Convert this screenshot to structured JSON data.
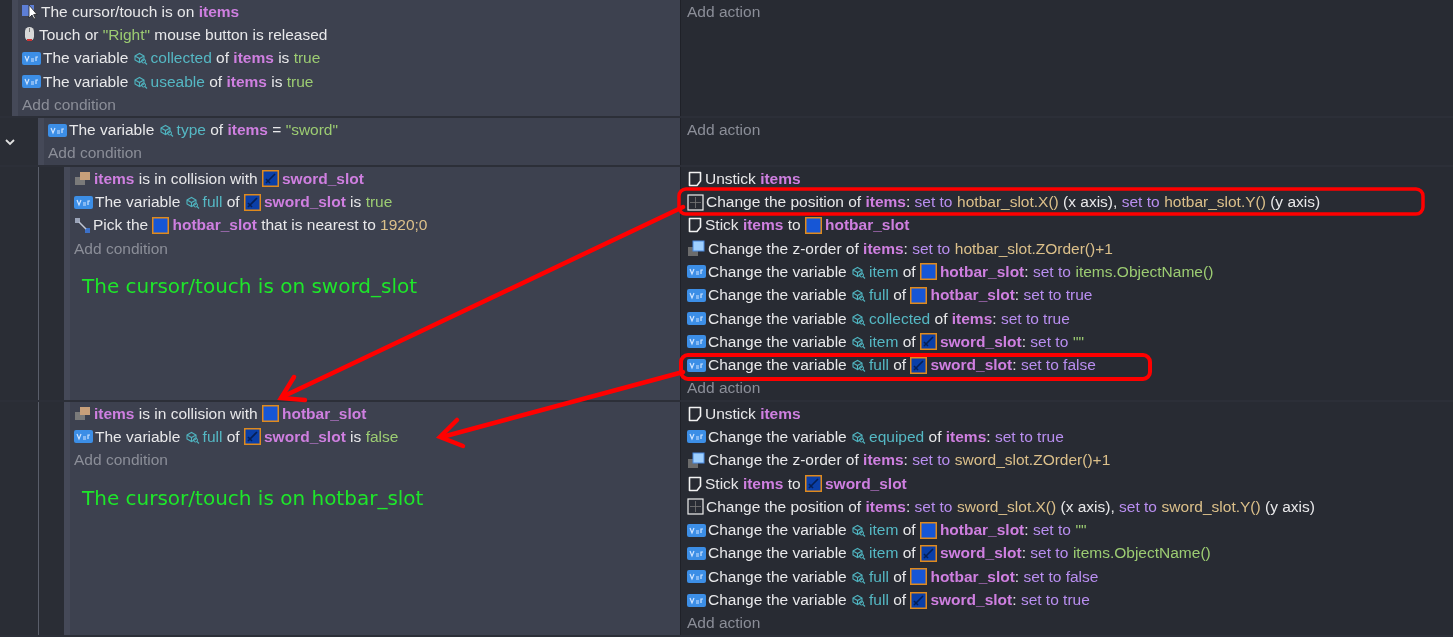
{
  "events": [
    {
      "conditions": [
        {
          "kind": "cursor",
          "parts": [
            {
              "t": "The cursor/touch is on ",
              "kind": "text"
            },
            {
              "t": "items",
              "kind": "object"
            }
          ]
        },
        {
          "kind": "mouse",
          "parts": [
            {
              "t": "Touch or ",
              "kind": "text"
            },
            {
              "t": "\"Right\"",
              "kind": "value"
            },
            {
              "t": " mouse button is released",
              "kind": "text"
            }
          ]
        },
        {
          "kind": "variable",
          "parts": [
            {
              "t": "The variable ",
              "kind": "text"
            },
            {
              "t": "collected",
              "kind": "var"
            },
            {
              "t": " of ",
              "kind": "text"
            },
            {
              "t": "items",
              "kind": "object"
            },
            {
              "t": " is ",
              "kind": "text"
            },
            {
              "t": "true",
              "kind": "value"
            }
          ]
        },
        {
          "kind": "variable",
          "parts": [
            {
              "t": "The variable ",
              "kind": "text"
            },
            {
              "t": "useable",
              "kind": "var"
            },
            {
              "t": " of ",
              "kind": "text"
            },
            {
              "t": "items",
              "kind": "object"
            },
            {
              "t": " is ",
              "kind": "text"
            },
            {
              "t": "true",
              "kind": "value"
            }
          ]
        }
      ],
      "add_condition": "Add condition",
      "add_action": "Add action",
      "children": [
        {
          "expanded": true,
          "conditions": [
            {
              "kind": "variable",
              "parts": [
                {
                  "t": "The variable ",
                  "kind": "text"
                },
                {
                  "t": "type",
                  "kind": "var"
                },
                {
                  "t": " of ",
                  "kind": "text"
                },
                {
                  "t": "items",
                  "kind": "object"
                },
                {
                  "t": " = ",
                  "kind": "text"
                },
                {
                  "t": "\"sword\"",
                  "kind": "value"
                }
              ]
            }
          ],
          "add_condition": "Add condition",
          "add_action": "Add action",
          "children": [
            {
              "conditions": [
                {
                  "kind": "collision",
                  "parts": [
                    {
                      "t": "items",
                      "kind": "object"
                    },
                    {
                      "t": " is in collision with ",
                      "kind": "text"
                    },
                    {
                      "kind": "sword"
                    },
                    {
                      "t": "sword_slot",
                      "kind": "object"
                    }
                  ]
                },
                {
                  "kind": "variable",
                  "parts": [
                    {
                      "t": "The variable ",
                      "kind": "text"
                    },
                    {
                      "t": "full",
                      "kind": "var"
                    },
                    {
                      "t": " of ",
                      "kind": "text"
                    },
                    {
                      "kind": "sword"
                    },
                    {
                      "t": "sword_slot",
                      "kind": "object"
                    },
                    {
                      "t": " is ",
                      "kind": "text"
                    },
                    {
                      "t": "true",
                      "kind": "value"
                    }
                  ]
                },
                {
                  "kind": "pick",
                  "parts": [
                    {
                      "t": "Pick the ",
                      "kind": "text"
                    },
                    {
                      "kind": "slot"
                    },
                    {
                      "t": "hotbar_slot",
                      "kind": "object"
                    },
                    {
                      "t": " that is nearest to ",
                      "kind": "text"
                    },
                    {
                      "t": "1920;0",
                      "kind": "expr"
                    }
                  ]
                }
              ],
              "add_condition": "Add condition",
              "annotation": "The cursor/touch is on sword_slot",
              "actions": [
                {
                  "kind": "note",
                  "parts": [
                    {
                      "t": "Unstick ",
                      "kind": "text"
                    },
                    {
                      "t": "items",
                      "kind": "object"
                    }
                  ]
                },
                {
                  "kind": "position",
                  "parts": [
                    {
                      "t": "Change the position of ",
                      "kind": "text"
                    },
                    {
                      "t": "items",
                      "kind": "object"
                    },
                    {
                      "t": ": ",
                      "kind": "text"
                    },
                    {
                      "t": "set to",
                      "kind": "param"
                    },
                    {
                      "t": "hotbar_slot.X()",
                      "kind": "expr"
                    },
                    {
                      "t": " (x axis), ",
                      "kind": "text"
                    },
                    {
                      "t": "set to",
                      "kind": "param"
                    },
                    {
                      "t": "hotbar_slot.Y()",
                      "kind": "expr"
                    },
                    {
                      "t": " (y axis)",
                      "kind": "text"
                    }
                  ]
                },
                {
                  "kind": "note",
                  "parts": [
                    {
                      "t": "Stick ",
                      "kind": "text"
                    },
                    {
                      "t": "items",
                      "kind": "object"
                    },
                    {
                      "t": " to ",
                      "kind": "text"
                    },
                    {
                      "kind": "slot"
                    },
                    {
                      "t": "hotbar_slot",
                      "kind": "object"
                    }
                  ]
                },
                {
                  "kind": "zorder",
                  "parts": [
                    {
                      "t": "Change the z-order of ",
                      "kind": "text"
                    },
                    {
                      "t": "items",
                      "kind": "object"
                    },
                    {
                      "t": ": ",
                      "kind": "text"
                    },
                    {
                      "t": "set to",
                      "kind": "param"
                    },
                    {
                      "t": "hotbar_slot.ZOrder()+1",
                      "kind": "expr"
                    }
                  ]
                },
                {
                  "kind": "variable",
                  "parts": [
                    {
                      "t": "Change the variable ",
                      "kind": "text"
                    },
                    {
                      "t": "item",
                      "kind": "var"
                    },
                    {
                      "t": " of ",
                      "kind": "text"
                    },
                    {
                      "kind": "slot"
                    },
                    {
                      "t": "hotbar_slot",
                      "kind": "object"
                    },
                    {
                      "t": ": ",
                      "kind": "text"
                    },
                    {
                      "t": "set to",
                      "kind": "param"
                    },
                    {
                      "t": "items.ObjectName()",
                      "kind": "value"
                    }
                  ]
                },
                {
                  "kind": "variable",
                  "parts": [
                    {
                      "t": "Change the variable ",
                      "kind": "text"
                    },
                    {
                      "t": "full",
                      "kind": "var"
                    },
                    {
                      "t": " of ",
                      "kind": "text"
                    },
                    {
                      "kind": "slot"
                    },
                    {
                      "t": "hotbar_slot",
                      "kind": "object"
                    },
                    {
                      "t": ": ",
                      "kind": "text"
                    },
                    {
                      "t": "set to true",
                      "kind": "param"
                    }
                  ]
                },
                {
                  "kind": "variable",
                  "parts": [
                    {
                      "t": "Change the variable ",
                      "kind": "text"
                    },
                    {
                      "t": "collected",
                      "kind": "var"
                    },
                    {
                      "t": " of ",
                      "kind": "text"
                    },
                    {
                      "t": "items",
                      "kind": "object"
                    },
                    {
                      "t": ": ",
                      "kind": "text"
                    },
                    {
                      "t": "set to true",
                      "kind": "param"
                    }
                  ]
                },
                {
                  "kind": "variable",
                  "parts": [
                    {
                      "t": "Change the variable ",
                      "kind": "text"
                    },
                    {
                      "t": "item",
                      "kind": "var"
                    },
                    {
                      "t": " of ",
                      "kind": "text"
                    },
                    {
                      "kind": "sword"
                    },
                    {
                      "t": "sword_slot",
                      "kind": "object"
                    },
                    {
                      "t": ": ",
                      "kind": "text"
                    },
                    {
                      "t": "set to",
                      "kind": "param"
                    },
                    {
                      "t": "\"\"",
                      "kind": "value"
                    }
                  ]
                },
                {
                  "kind": "variable",
                  "parts": [
                    {
                      "t": "Change the variable ",
                      "kind": "text"
                    },
                    {
                      "t": "full",
                      "kind": "var"
                    },
                    {
                      "t": " of ",
                      "kind": "text"
                    },
                    {
                      "kind": "sword"
                    },
                    {
                      "t": "sword_slot",
                      "kind": "object"
                    },
                    {
                      "t": ": ",
                      "kind": "text"
                    },
                    {
                      "t": "set to false",
                      "kind": "param"
                    }
                  ]
                }
              ],
              "add_action": "Add action"
            },
            {
              "conditions": [
                {
                  "kind": "collision",
                  "parts": [
                    {
                      "t": "items",
                      "kind": "object"
                    },
                    {
                      "t": " is in collision with ",
                      "kind": "text"
                    },
                    {
                      "kind": "slot"
                    },
                    {
                      "t": "hotbar_slot",
                      "kind": "object"
                    }
                  ]
                },
                {
                  "kind": "variable",
                  "parts": [
                    {
                      "t": "The variable ",
                      "kind": "text"
                    },
                    {
                      "t": "full",
                      "kind": "var"
                    },
                    {
                      "t": " of ",
                      "kind": "text"
                    },
                    {
                      "kind": "sword"
                    },
                    {
                      "t": "sword_slot",
                      "kind": "object"
                    },
                    {
                      "t": " is ",
                      "kind": "text"
                    },
                    {
                      "t": "false",
                      "kind": "value"
                    }
                  ]
                }
              ],
              "add_condition": "Add condition",
              "annotation": "The cursor/touch is on hotbar_slot",
              "actions": [
                {
                  "kind": "note",
                  "parts": [
                    {
                      "t": "Unstick ",
                      "kind": "text"
                    },
                    {
                      "t": "items",
                      "kind": "object"
                    }
                  ]
                },
                {
                  "kind": "variable",
                  "parts": [
                    {
                      "t": "Change the variable ",
                      "kind": "text"
                    },
                    {
                      "t": "equiped",
                      "kind": "var"
                    },
                    {
                      "t": " of ",
                      "kind": "text"
                    },
                    {
                      "t": "items",
                      "kind": "object"
                    },
                    {
                      "t": ": ",
                      "kind": "text"
                    },
                    {
                      "t": "set to true",
                      "kind": "param"
                    }
                  ]
                },
                {
                  "kind": "zorder",
                  "parts": [
                    {
                      "t": "Change the z-order of ",
                      "kind": "text"
                    },
                    {
                      "t": "items",
                      "kind": "object"
                    },
                    {
                      "t": ": ",
                      "kind": "text"
                    },
                    {
                      "t": "set to",
                      "kind": "param"
                    },
                    {
                      "t": "sword_slot.ZOrder()+1",
                      "kind": "expr"
                    }
                  ]
                },
                {
                  "kind": "note",
                  "parts": [
                    {
                      "t": "Stick ",
                      "kind": "text"
                    },
                    {
                      "t": "items",
                      "kind": "object"
                    },
                    {
                      "t": " to ",
                      "kind": "text"
                    },
                    {
                      "kind": "sword"
                    },
                    {
                      "t": "sword_slot",
                      "kind": "object"
                    }
                  ]
                },
                {
                  "kind": "position",
                  "parts": [
                    {
                      "t": "Change the position of ",
                      "kind": "text"
                    },
                    {
                      "t": "items",
                      "kind": "object"
                    },
                    {
                      "t": ": ",
                      "kind": "text"
                    },
                    {
                      "t": "set to",
                      "kind": "param"
                    },
                    {
                      "t": "sword_slot.X()",
                      "kind": "expr"
                    },
                    {
                      "t": " (x axis), ",
                      "kind": "text"
                    },
                    {
                      "t": "set to",
                      "kind": "param"
                    },
                    {
                      "t": "sword_slot.Y()",
                      "kind": "expr"
                    },
                    {
                      "t": " (y axis)",
                      "kind": "text"
                    }
                  ]
                },
                {
                  "kind": "variable",
                  "parts": [
                    {
                      "t": "Change the variable ",
                      "kind": "text"
                    },
                    {
                      "t": "item",
                      "kind": "var"
                    },
                    {
                      "t": " of ",
                      "kind": "text"
                    },
                    {
                      "kind": "slot"
                    },
                    {
                      "t": "hotbar_slot",
                      "kind": "object"
                    },
                    {
                      "t": ": ",
                      "kind": "text"
                    },
                    {
                      "t": "set to",
                      "kind": "param"
                    },
                    {
                      "t": "\"\"",
                      "kind": "value"
                    }
                  ]
                },
                {
                  "kind": "variable",
                  "parts": [
                    {
                      "t": "Change the variable ",
                      "kind": "text"
                    },
                    {
                      "t": "item",
                      "kind": "var"
                    },
                    {
                      "t": " of ",
                      "kind": "text"
                    },
                    {
                      "kind": "sword"
                    },
                    {
                      "t": "sword_slot",
                      "kind": "object"
                    },
                    {
                      "t": ": ",
                      "kind": "text"
                    },
                    {
                      "t": "set to",
                      "kind": "param"
                    },
                    {
                      "t": "items.ObjectName()",
                      "kind": "value"
                    }
                  ]
                },
                {
                  "kind": "variable",
                  "parts": [
                    {
                      "t": "Change the variable ",
                      "kind": "text"
                    },
                    {
                      "t": "full",
                      "kind": "var"
                    },
                    {
                      "t": " of ",
                      "kind": "text"
                    },
                    {
                      "kind": "slot"
                    },
                    {
                      "t": "hotbar_slot",
                      "kind": "object"
                    },
                    {
                      "t": ": ",
                      "kind": "text"
                    },
                    {
                      "t": "set to false",
                      "kind": "param"
                    }
                  ]
                },
                {
                  "kind": "variable",
                  "parts": [
                    {
                      "t": "Change the variable ",
                      "kind": "text"
                    },
                    {
                      "t": "full",
                      "kind": "var"
                    },
                    {
                      "t": " of ",
                      "kind": "text"
                    },
                    {
                      "kind": "sword"
                    },
                    {
                      "t": "sword_slot",
                      "kind": "object"
                    },
                    {
                      "t": ": ",
                      "kind": "text"
                    },
                    {
                      "t": "set to true",
                      "kind": "param"
                    }
                  ]
                }
              ],
              "add_action": "Add action"
            }
          ]
        }
      ]
    }
  ]
}
